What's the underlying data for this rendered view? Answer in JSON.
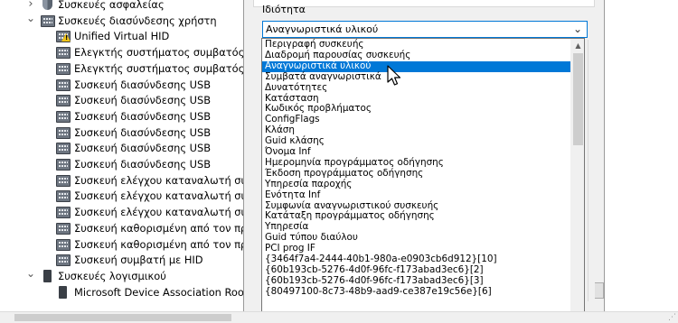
{
  "tree": {
    "rows": [
      {
        "label": "Συσκευές ασφαλείας",
        "indent": 0,
        "expander": "collapsed",
        "icon": "security-device-icon",
        "warning": false
      },
      {
        "label": "Συσκευές διασύνδεσης χρήστη",
        "indent": 0,
        "expander": "expanded",
        "icon": "hid-keyboard-icon",
        "warning": false
      },
      {
        "label": "Unified Virtual HID",
        "indent": 1,
        "expander": "none",
        "icon": "hid-keyboard-icon",
        "warning": true
      },
      {
        "label": "Ελεγκτής συστήματος συμβατός μ",
        "indent": 1,
        "expander": "none",
        "icon": "hid-keyboard-icon",
        "warning": false
      },
      {
        "label": "Ελεγκτής συστήματος συμβατός μ",
        "indent": 1,
        "expander": "none",
        "icon": "hid-keyboard-icon",
        "warning": false
      },
      {
        "label": "Συσκευή διασύνδεσης USB",
        "indent": 1,
        "expander": "none",
        "icon": "hid-keyboard-icon",
        "warning": false
      },
      {
        "label": "Συσκευή διασύνδεσης USB",
        "indent": 1,
        "expander": "none",
        "icon": "hid-keyboard-icon",
        "warning": false
      },
      {
        "label": "Συσκευή διασύνδεσης USB",
        "indent": 1,
        "expander": "none",
        "icon": "hid-keyboard-icon",
        "warning": false
      },
      {
        "label": "Συσκευή διασύνδεσης USB",
        "indent": 1,
        "expander": "none",
        "icon": "hid-keyboard-icon",
        "warning": false
      },
      {
        "label": "Συσκευή διασύνδεσης USB",
        "indent": 1,
        "expander": "none",
        "icon": "hid-keyboard-icon",
        "warning": false
      },
      {
        "label": "Συσκευή διασύνδεσης USB",
        "indent": 1,
        "expander": "none",
        "icon": "hid-keyboard-icon",
        "warning": false
      },
      {
        "label": "Συσκευή ελέγχου καταναλωτή συμ",
        "indent": 1,
        "expander": "none",
        "icon": "hid-keyboard-icon",
        "warning": false
      },
      {
        "label": "Συσκευή ελέγχου καταναλωτή συμ",
        "indent": 1,
        "expander": "none",
        "icon": "hid-keyboard-icon",
        "warning": false
      },
      {
        "label": "Συσκευή ελέγχου καταναλωτή συμ",
        "indent": 1,
        "expander": "none",
        "icon": "hid-keyboard-icon",
        "warning": false
      },
      {
        "label": "Συσκευή καθορισμένη από τον προ",
        "indent": 1,
        "expander": "none",
        "icon": "hid-keyboard-icon",
        "warning": false
      },
      {
        "label": "Συσκευή καθορισμένη από τον προ",
        "indent": 1,
        "expander": "none",
        "icon": "hid-keyboard-icon",
        "warning": false
      },
      {
        "label": "Συσκευή συμβατή με HID",
        "indent": 1,
        "expander": "none",
        "icon": "hid-keyboard-icon",
        "warning": false
      },
      {
        "label": "Συσκευές λογισμικού",
        "indent": 0,
        "expander": "expanded",
        "icon": "software-device-icon",
        "warning": false
      },
      {
        "label": "Microsoft Device Association Root",
        "indent": 1,
        "expander": "none",
        "icon": "software-device-icon",
        "warning": false
      }
    ]
  },
  "dialog": {
    "property_label": "Ιδιότητα",
    "selected_property": "Αναγνωριστικά υλικού"
  },
  "dropdown": {
    "selected_index": 2,
    "options": [
      "Περιγραφή συσκευής",
      "Διαδρομή παρουσίας συσκευής",
      "Αναγνωριστικά υλικού",
      "Συμβατά αναγνωριστικά",
      "Δυνατότητες",
      "Κατάσταση",
      "Κωδικός προβλήματος",
      "ConfigFlags",
      "Κλάση",
      "Guid κλάσης",
      "Όνομα Inf",
      "Ημερομηνία προγράμματος οδήγησης",
      "Έκδοση προγράμματος οδήγησης",
      "Υπηρεσία παροχής",
      "Ενότητα Inf",
      "Συμφωνία αναγνωριστικού συσκευής",
      "Κατάταξη προγράμματος οδήγησης",
      "Υπηρεσία",
      "Guid τύπου διαύλου",
      "PCI prog IF",
      "{3464f7a4-2444-40b1-980a-e0903cb6d912}[10]",
      "{60b193cb-5276-4d0f-96fc-f173abad3ec6}[2]",
      "{60b193cb-5276-4d0f-96fc-f173abad3ec6}[3]",
      "{80497100-8c73-48b9-aad9-ce387e19c56e}[6]"
    ]
  },
  "colors": {
    "selection": "#0078d7",
    "focus_border": "#0078d7",
    "warning": "#f0c419"
  }
}
